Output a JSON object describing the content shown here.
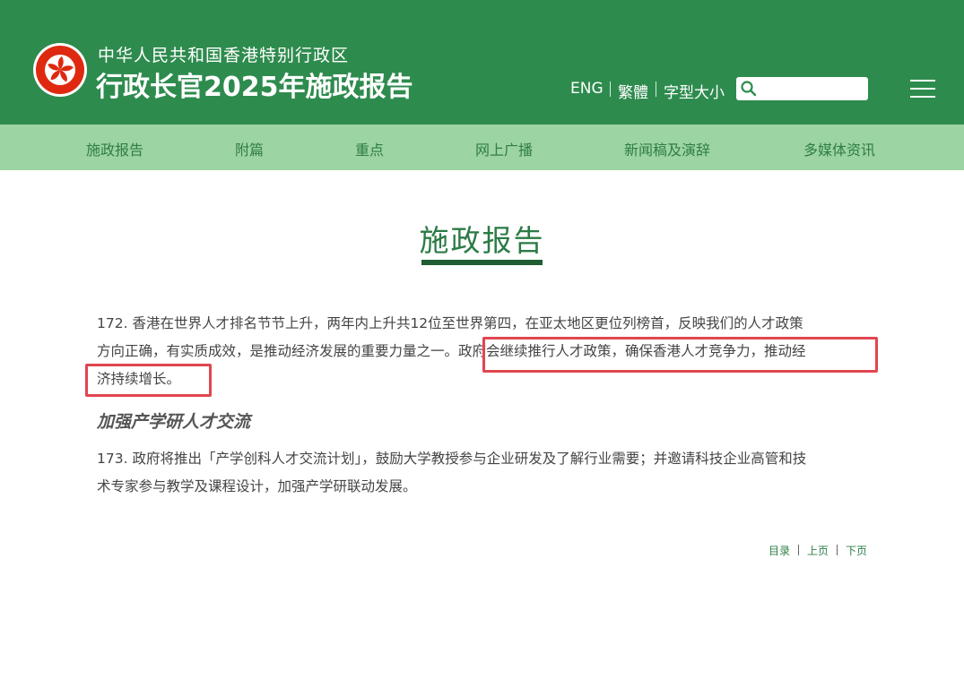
{
  "header": {
    "subtitle": "中华人民共和国香港特别行政区",
    "title": "行政长官2025年施政报告",
    "lang_links": [
      "ENG",
      "繁體",
      "字型大小"
    ],
    "search_placeholder": "",
    "menu_icon": "hamburger-menu-icon",
    "colors": {
      "header_bg": "#2e8b4e",
      "nav_bg": "#9dd4a3",
      "nav_text": "#2f7d46"
    }
  },
  "nav": {
    "items": [
      "施政报告",
      "附篇",
      "重点",
      "网上广播",
      "新闻稿及演辞",
      "多媒体资讯"
    ]
  },
  "main": {
    "page_title": "施政报告",
    "para172": {
      "line1": "172. 香港在世界人才排名节节上升，两年内上升共12位至世界第四，在亚太地区更位列榜首，反映我们的人才政策",
      "line2_plain": "方向正确，有实质成效，是推动经济发展的重要力量之一。",
      "line2_highlight": "政府会继续推行人才政策，确保香港人才竞争力，推动经",
      "line3_highlight": "济持续增长。"
    },
    "subheading": "加强产学研人才交流",
    "para173": {
      "line1": "173. 政府将推出「产学创科人才交流计划」，鼓励大学教授参与企业研发及了解行业需要；并邀请科技企业高管和技",
      "line2": "术专家参与教学及课程设计，加强产学研联动发展。"
    },
    "highlight_color": "#e0464f"
  },
  "pager": {
    "toc": "目录",
    "prev": "上页",
    "next": "下页"
  }
}
